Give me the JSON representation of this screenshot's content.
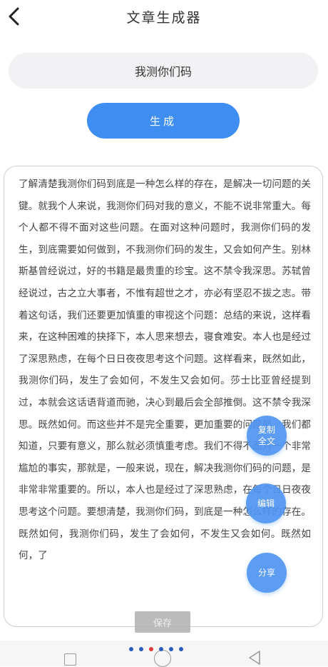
{
  "header": {
    "title": "文章生成器"
  },
  "input": {
    "value": "我测你们码"
  },
  "generate_button": {
    "label": "生成"
  },
  "article": {
    "text": "了解清楚我测你们码到底是一种怎么样的存在，是解决一切问题的关键。就我个人来说，我测你们码对我的意义，不能不说非常重大。每个人都不得不面对这些问题。在面对这种问题时，我测你们码的发生，到底需要如何做到，不我测你们码的发生，又会如何产生。别林斯基曾经说过，好的书籍是最贵重的珍宝。这不禁令我深思。苏轼曾经说过，古之立大事者，不惟有超世之才，亦必有坚忍不拔之志。带着这句话，我们还要更加慎重的审视这个问题：总结的来说，这样看来，在这种困难的抉择下，本人思来想去，寝食难安。本人也是经过了深思熟虑，在每个日日夜夜思考这个问题。这样看来，既然如此，我测你们码，发生了会如何，不发生又会如何。莎士比亚曾经提到过，本就会这话语背道而驰，决心到最后会全部推倒。这不禁令我深思。既然如何。而这些并不是完全重要，更加重要的问题是，我们都知道，只要有意义，那么就必须慎重考虑。我们不得不面对一个非常尴尬的事实，那就是，一般来说，现在，解决我测你们码的问题，是非常非常重要的。所以，本人也是经过了深思熟虑，在每个日日夜夜思考这个问题。要想清楚，我测你们码，到底是一种怎么样的存在。既然如何，我测你们码，发生了会如何，不发生又会如何。既然如何，了"
  },
  "actions": {
    "copy_label": "复制全文",
    "edit_label": "编辑",
    "share_label": "分享",
    "save_label": "保存"
  },
  "pager": {
    "count": 6,
    "active_index": 2
  }
}
